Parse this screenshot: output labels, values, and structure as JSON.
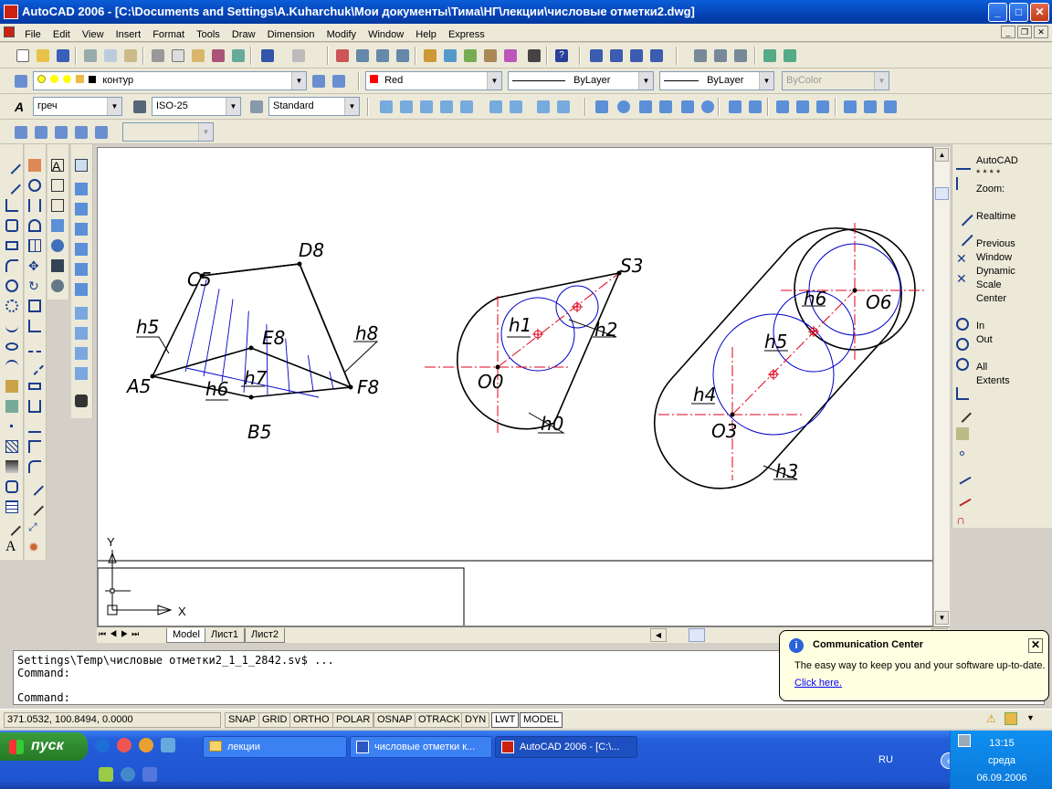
{
  "window": {
    "title": "AutoCAD 2006 - [C:\\Documents and Settings\\A.Kuharchuk\\Мои документы\\Тима\\НГ\\лекции\\числовые отметки2.dwg]"
  },
  "menu": [
    "File",
    "Edit",
    "View",
    "Insert",
    "Format",
    "Tools",
    "Draw",
    "Dimension",
    "Modify",
    "Window",
    "Help",
    "Express"
  ],
  "layers_toolbar": {
    "layer": "контур",
    "color": "Red",
    "linetype": "ByLayer",
    "lineweight": "ByLayer",
    "plotstyle": "ByColor"
  },
  "styles_toolbar": {
    "text_style": "греч",
    "dim_style": "ISO-25",
    "table_style": "Standard"
  },
  "zoom_panel": {
    "lines": [
      "AutoCAD",
      "* * * *",
      "Zoom:",
      "Realtime",
      "Previous",
      "Window",
      "Dynamic",
      "Scale",
      "Center",
      "In",
      "Out",
      "All",
      "Extents"
    ]
  },
  "drawing": {
    "labels": {
      "D8": "D8",
      "S3": "S3",
      "C5": "C5",
      "h5a": "h5",
      "E8": "E8",
      "h8": "h8",
      "A5": "A5",
      "h7": "h7",
      "h6a": "h6",
      "F8": "F8",
      "B5": "B5",
      "h1": "h1",
      "h2": "h2",
      "O0": "O0",
      "h0": "h0",
      "h6b": "h6",
      "O6": "O6",
      "h5b": "h5",
      "h4": "h4",
      "O3": "O3",
      "h3": "h3"
    },
    "ucs": {
      "y": "Y",
      "x": "X"
    }
  },
  "layout_tabs": [
    "Model",
    "Лист1",
    "Лист2"
  ],
  "command": {
    "line1": "Settings\\Temp\\числовые отметки2_1_1_2842.sv$ ...",
    "line2": "Command:",
    "line3": "Command:"
  },
  "status": {
    "coords": "371.0532, 100.8494, 0.0000",
    "buttons": [
      "SNAP",
      "GRID",
      "ORTHO",
      "POLAR",
      "OSNAP",
      "OTRACK",
      "DYN",
      "LWT",
      "MODEL"
    ]
  },
  "balloon": {
    "title": "Communication Center",
    "body": "The easy way to keep you and your software up-to-date.",
    "link": "Click here."
  },
  "taskbar": {
    "start": "пуск",
    "tasks": [
      "лекции",
      "числовые отметки к...",
      "AutoCAD 2006 - [C:\\..."
    ],
    "lang": "RU",
    "time": "13:15",
    "day": "среда",
    "date": "06.09.2006"
  },
  "colors": {
    "drawing_red": "#e0001b",
    "drawing_blue": "#0000c8",
    "titlebar": "#0a5ed8",
    "taskbar": "#245edb"
  }
}
